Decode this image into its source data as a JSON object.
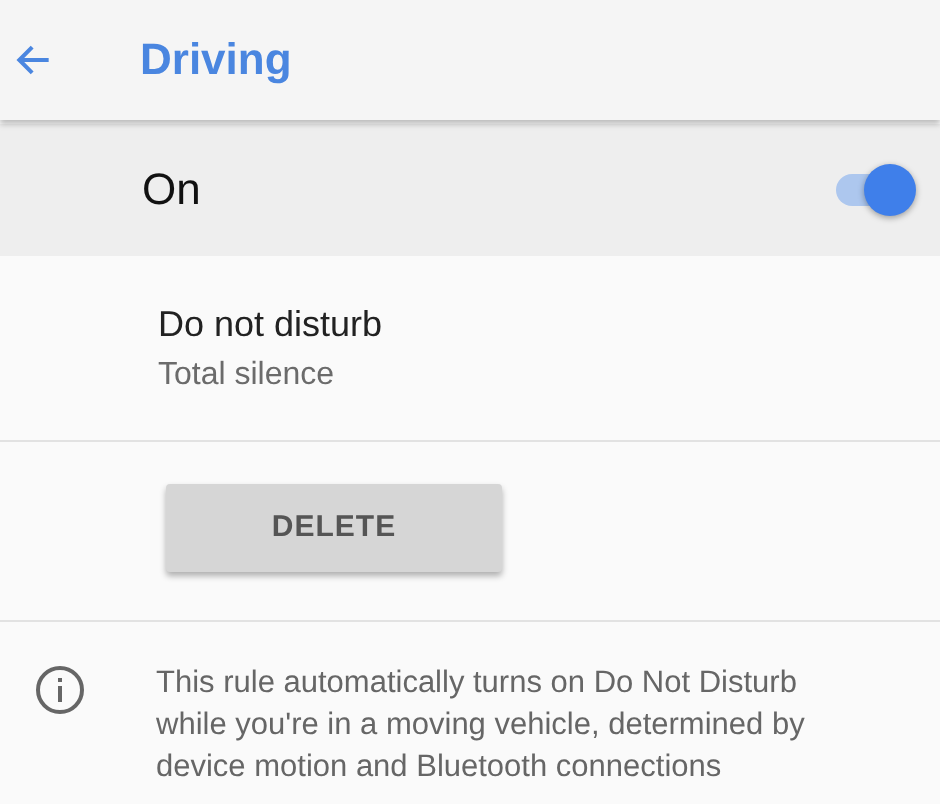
{
  "header": {
    "title": "Driving"
  },
  "master_switch": {
    "label": "On",
    "on": true
  },
  "setting": {
    "title": "Do not disturb",
    "summary": "Total silence"
  },
  "delete_button": {
    "label": "DELETE"
  },
  "info": {
    "text": "This rule automatically turns on Do Not Disturb while you're in a moving vehicle, determined by device motion and Bluetooth connections"
  }
}
